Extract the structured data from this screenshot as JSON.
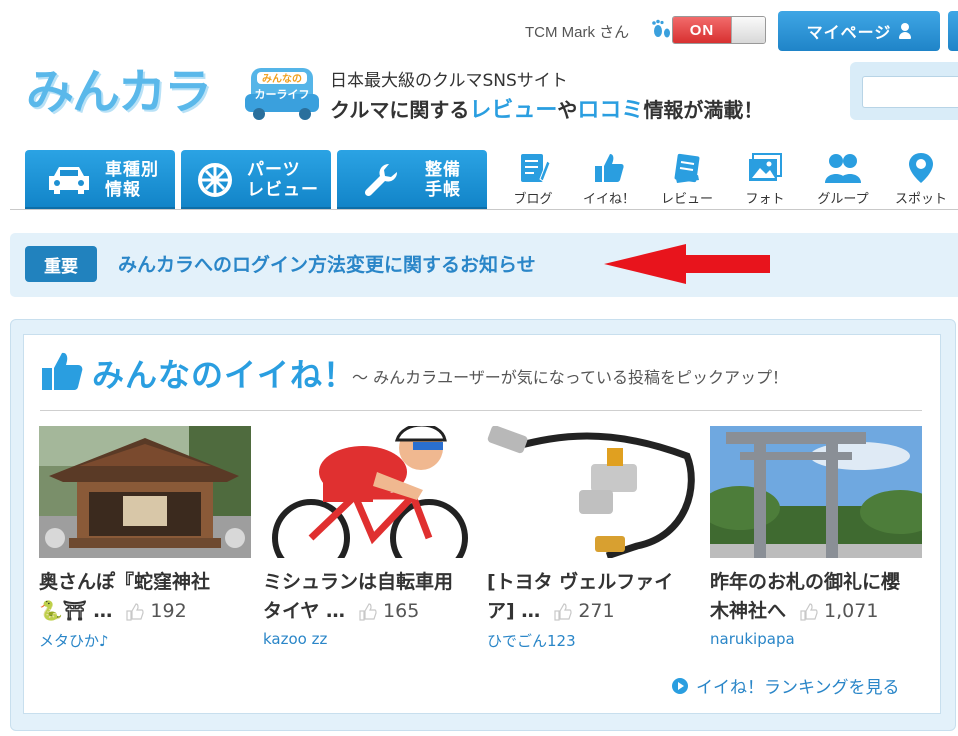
{
  "topbar": {
    "user_name": "TCM Mark さん",
    "toggle_label": "ON",
    "mypage_label": "マイページ"
  },
  "header": {
    "logo": "みんカラ",
    "badge_line1": "みんなの",
    "badge_line2": "カーライフ",
    "tagline1": "日本最大級のクルマSNSサイト",
    "tagline2_pre": "クルマに関する",
    "tagline2_hl1": "レビュー",
    "tagline2_mid": "や",
    "tagline2_hl2": "ロコミ",
    "tagline2_post": "情報が満載！"
  },
  "nav": {
    "big": [
      {
        "line1": "車種別",
        "line2": "情報",
        "icon": "car-icon"
      },
      {
        "line1": "パーツ",
        "line2": "レビュー",
        "icon": "wheel-icon"
      },
      {
        "line1": "整備",
        "line2": "手帳",
        "icon": "wrench-icon"
      }
    ],
    "small": [
      {
        "label": "ブログ",
        "icon": "blog-icon"
      },
      {
        "label": "イイね！",
        "icon": "like-icon"
      },
      {
        "label": "レビュー",
        "icon": "review-icon"
      },
      {
        "label": "フォト",
        "icon": "photo-icon"
      },
      {
        "label": "グループ",
        "icon": "group-icon"
      },
      {
        "label": "スポット",
        "icon": "spot-icon"
      }
    ]
  },
  "notice": {
    "badge": "重要",
    "message": "みんカラへのログイン方法変更に関するお知らせ"
  },
  "panel": {
    "title": "みんなのイイね！",
    "subtitle": "～ みんカラユーザーが気になっている投稿をピックアップ！",
    "more_link": "イイね！ランキングを見る",
    "cards": [
      {
        "title1": "奥さんぽ『蛇窪神社",
        "title2": "🐍⛩ …",
        "likes": "192",
        "author": "メタひか♪"
      },
      {
        "title1": "ミシュランは自転車用",
        "title2": "タイヤ …",
        "likes": "165",
        "author": "kazoo zz"
      },
      {
        "title1": "[トヨタ ヴェルファイ",
        "title2": "ア] …",
        "likes": "271",
        "author": "ひでごん123"
      },
      {
        "title1": "昨年のお札の御礼に櫻",
        "title2": "木神社へ",
        "likes": "1,071",
        "author": "narukipapa"
      }
    ]
  },
  "colors": {
    "accent": "#2a9ee0",
    "button": "#1f84c8",
    "notice_bg": "#e3f1fa",
    "toggle_on": "#d83030",
    "arrow": "#e8141c"
  }
}
